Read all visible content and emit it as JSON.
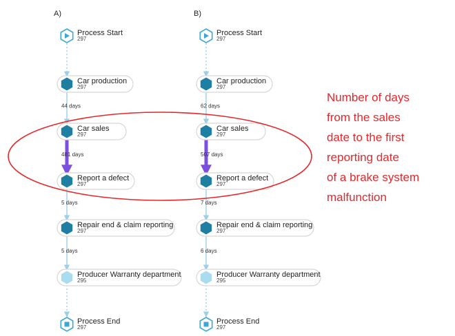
{
  "panels": [
    {
      "label": "A)",
      "nodes": [
        {
          "name": "Process Start",
          "count": "297",
          "kind": "start"
        },
        {
          "name": "Car production",
          "count": "297",
          "kind": "activity"
        },
        {
          "name": "Car sales",
          "count": "297",
          "kind": "activity"
        },
        {
          "name": "Report a defect",
          "count": "297",
          "kind": "activity"
        },
        {
          "name": "Repair end & claim reporting",
          "count": "297",
          "kind": "activity"
        },
        {
          "name": "Producer Warranty department",
          "count": "295",
          "kind": "activity-light"
        },
        {
          "name": "Process End",
          "count": "297",
          "kind": "end"
        }
      ],
      "edges": [
        {
          "label": "",
          "style": "dotted"
        },
        {
          "label": "44 days",
          "style": "solid"
        },
        {
          "label": "481 days",
          "style": "heavy"
        },
        {
          "label": "5 days",
          "style": "solid"
        },
        {
          "label": "5 days",
          "style": "solid"
        },
        {
          "label": "",
          "style": "dotted"
        }
      ]
    },
    {
      "label": "B)",
      "nodes": [
        {
          "name": "Process Start",
          "count": "297",
          "kind": "start"
        },
        {
          "name": "Car production",
          "count": "297",
          "kind": "activity"
        },
        {
          "name": "Car sales",
          "count": "297",
          "kind": "activity"
        },
        {
          "name": "Report a defect",
          "count": "297",
          "kind": "activity"
        },
        {
          "name": "Repair end & claim reporting",
          "count": "297",
          "kind": "activity"
        },
        {
          "name": "Producer Warranty department",
          "count": "295",
          "kind": "activity-light"
        },
        {
          "name": "Process End",
          "count": "297",
          "kind": "end"
        }
      ],
      "edges": [
        {
          "label": "",
          "style": "dotted"
        },
        {
          "label": "62 days",
          "style": "solid"
        },
        {
          "label": "507 days",
          "style": "heavy"
        },
        {
          "label": "7 days",
          "style": "solid"
        },
        {
          "label": "6 days",
          "style": "solid"
        },
        {
          "label": "",
          "style": "dotted"
        }
      ]
    }
  ],
  "annotation": {
    "lines": [
      "Number of days",
      "from the sales",
      "date to the first",
      "reporting date",
      "of a brake system",
      "malfunction"
    ]
  },
  "colors": {
    "activity": "#1f7fa3",
    "activity_light": "#a9dcef",
    "start_end_ring": "#3aa7d6",
    "edge": "#9bd0ea",
    "heavy_edge": "#7b4fe0",
    "annotation": "#e8262a",
    "node_border": "#d6d6d6"
  }
}
